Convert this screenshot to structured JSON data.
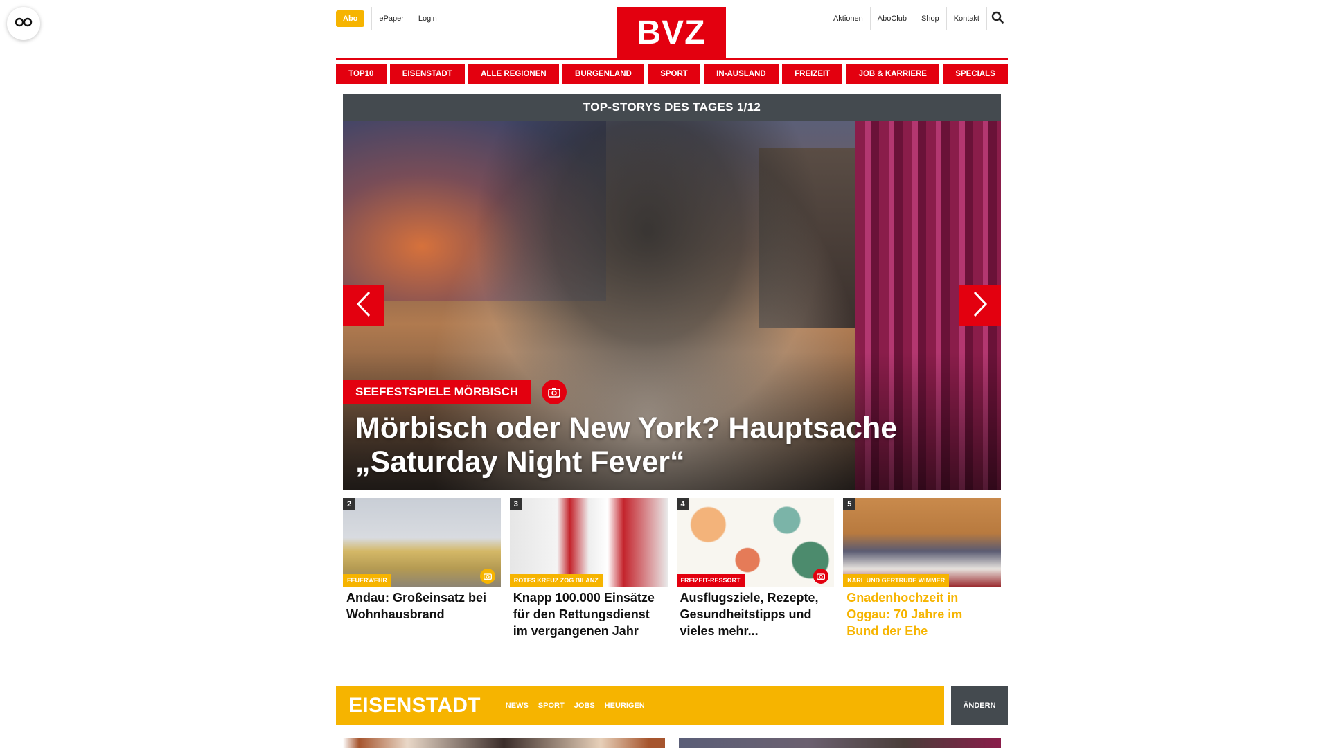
{
  "header": {
    "abo_label": "Abo",
    "left_links": [
      "ePaper",
      "Login"
    ],
    "logo_text": "BVZ",
    "right_links": [
      "Aktionen",
      "AboClub",
      "Shop",
      "Kontakt"
    ]
  },
  "nav": {
    "items": [
      "TOP10",
      "EISENSTADT",
      "ALLE REGIONEN",
      "BURGENLAND",
      "SPORT",
      "IN-AUSLAND",
      "FREIZEIT",
      "JOB & KARRIERE",
      "SPECIALS"
    ]
  },
  "top_stories": {
    "heading": "TOP-STORYS DES TAGES 1/12",
    "hero": {
      "kicker": "SEEFESTSPIELE MÖRBISCH",
      "title": "Mörbisch oder New York? Hauptsache „Saturday Night Fever“"
    },
    "teasers": [
      {
        "num": "2",
        "tag": "FEUERWEHR",
        "title": "Andau: Großeinsatz bei Wohnhausbrand"
      },
      {
        "num": "3",
        "tag": "ROTES KREUZ ZOG BILANZ",
        "title": "Knapp 100.000 Einsätze für den Rettungsdienst im vergangenen Jahr"
      },
      {
        "num": "4",
        "tag": "FREIZEIT-RESSORT",
        "title": "Ausflugsziele, Rezepte, Gesundheitstipps und vieles mehr..."
      },
      {
        "num": "5",
        "tag": "KARL UND GERTRUDE WIMMER",
        "title": "Gnadenhochzeit in Oggau: 70 Jahre im Bund der Ehe"
      }
    ]
  },
  "region": {
    "title": "EISENSTADT",
    "links": [
      "NEWS",
      "SPORT",
      "JOBS",
      "HEURIGEN"
    ],
    "change_label": "ÄNDERN"
  },
  "colors": {
    "brand_red": "#e3000f",
    "accent_yellow": "#f6b400",
    "dark_bar": "#444a4f"
  }
}
